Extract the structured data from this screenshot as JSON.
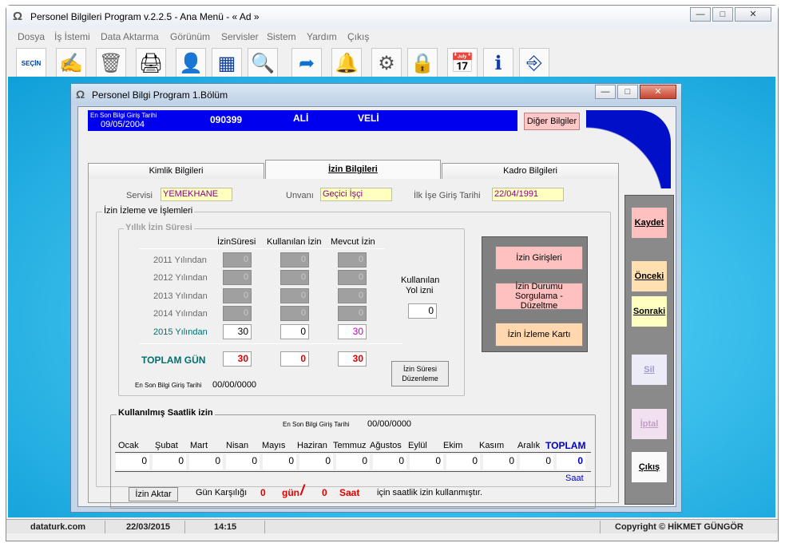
{
  "app": {
    "title": "Personel Bilgileri Program v.2.2.5  - Ana Menü -  « Ad »"
  },
  "menu": [
    "Dosya",
    "İş İstemi",
    "Data Aktarma",
    "Görünüm",
    "Servisler",
    "Sistem",
    "Yardım",
    "Çıkış"
  ],
  "toolbar": {
    "secin_label": "SEÇİN"
  },
  "status": {
    "site": "dataturk.com",
    "date": "22/03/2015",
    "time": "14:15",
    "copyright": "Copyright © HİKMET GÜNGÖR"
  },
  "child": {
    "title": "Personel Bilgi Program 1.Bölüm",
    "header": {
      "last_entry_label": "En Son Bilgi Giriş Tarihi",
      "last_entry_date": "09/05/2004",
      "id": "090399",
      "first_name": "ALİ",
      "last_name": "VELİ",
      "other_button": "Diğer Bilgiler"
    },
    "tabs": [
      "Kimlik Bilgileri",
      "İzin Bilgileri",
      "Kadro Bilgileri"
    ],
    "fields": {
      "servis_label": "Servisi",
      "servis_value": "YEMEKHANE",
      "unvan_label": "Unvanı",
      "unvan_value": "Geçici İşçi",
      "ilk_label": "İlk İşe Giriş Tarihi",
      "ilk_value": "22/04/1991"
    },
    "izin_izleme_legend": "İzin İzleme ve İşlemleri",
    "yillik": {
      "legend": "Yıllık İzin Süresi",
      "col_headers": [
        "İzinSüresi",
        "Kullanılan İzin",
        "Mevcut İzin"
      ],
      "rows": [
        {
          "year": "2011 Yılından",
          "izin": "0",
          "kullanilan": "0",
          "mevcut": "0"
        },
        {
          "year": "2012 Yılından",
          "izin": "0",
          "kullanilan": "0",
          "mevcut": "0"
        },
        {
          "year": "2013 Yılından",
          "izin": "0",
          "kullanilan": "0",
          "mevcut": "0"
        },
        {
          "year": "2014 Yılından",
          "izin": "0",
          "kullanilan": "0",
          "mevcut": "0"
        },
        {
          "year": "2015 Yılından",
          "izin": "30",
          "kullanilan": "0",
          "mevcut": "30"
        }
      ],
      "total_label": "TOPLAM GÜN",
      "total": {
        "izin": "30",
        "kullanilan": "0",
        "mevcut": "30"
      },
      "yol_label_1": "Kullanılan",
      "yol_label_2": "Yol izni",
      "yol_value": "0",
      "last_entry_label": "En Son Bilgi Giriş Tarihi",
      "last_entry_value": "00/00/0000",
      "duzenle_button_1": "İzin Süresi",
      "duzenle_button_2": "Düzenleme"
    },
    "izin_buttons": {
      "girisleri": "İzin Girişleri",
      "durum_1": "İzin Durumu",
      "durum_2": "Sorgulama - Düzeltme",
      "kart": "İzin İzleme Kartı"
    },
    "saatlik": {
      "legend": "Kullanılmış Saatlik izin",
      "last_entry_label": "En Son Bilgi Giriş Tarihi",
      "last_entry_value": "00/00/0000",
      "months": [
        "Ocak",
        "Şubat",
        "Mart",
        "Nisan",
        "Mayıs",
        "Haziran",
        "Temmuz",
        "Ağustos",
        "Eylül",
        "Ekim",
        "Kasım",
        "Aralık"
      ],
      "values": [
        "0",
        "0",
        "0",
        "0",
        "0",
        "0",
        "0",
        "0",
        "0",
        "0",
        "0",
        "0"
      ],
      "total_label": "TOPLAM",
      "total_value": "0",
      "unit": "Saat",
      "aktar_button": "İzin Aktar",
      "gun_karsiligi": "Gün Karşılığı",
      "gun_value": "0",
      "gun_label": "gün",
      "slash": "/",
      "saat_value": "0",
      "saat_label": "Saat",
      "suffix": "için saatlik izin kullanmıştır."
    },
    "side_buttons": [
      "Kaydet",
      "Önceki",
      "Sonraki",
      "Sil",
      "İptal",
      "Çıkış"
    ]
  }
}
